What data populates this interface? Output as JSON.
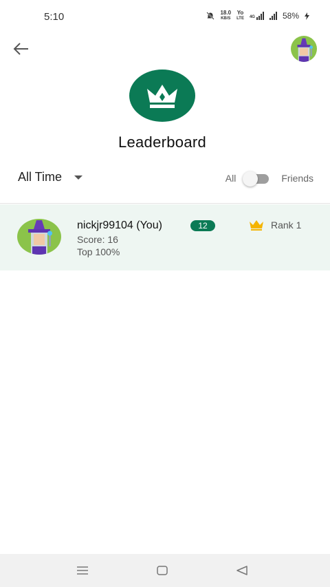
{
  "status": {
    "time": "5:10",
    "net_speed_value": "18.0",
    "net_speed_unit": "KB/S",
    "volte_top": "Yo",
    "volte_bottom": "LTE",
    "net_type": "4G",
    "battery": "58%"
  },
  "header": {
    "back_icon": "arrow-left-icon",
    "avatar_icon": "wizard-avatar"
  },
  "hero": {
    "icon": "crown-icon",
    "title": "Leaderboard",
    "accent_color": "#0b7a55"
  },
  "filter": {
    "selected": "All Time"
  },
  "toggle": {
    "left_label": "All",
    "right_label": "Friends",
    "state": "all"
  },
  "entries": [
    {
      "name": "nickjr99104 (You)",
      "level": "12",
      "score_text": "Score: 16",
      "top_text": "Top 100%",
      "rank_text": "Rank 1",
      "rank_icon": "crown-icon",
      "highlight_color": "#eef6f2"
    }
  ],
  "nav": {
    "items": [
      "menu-icon",
      "home-square-icon",
      "back-triangle-icon"
    ]
  }
}
